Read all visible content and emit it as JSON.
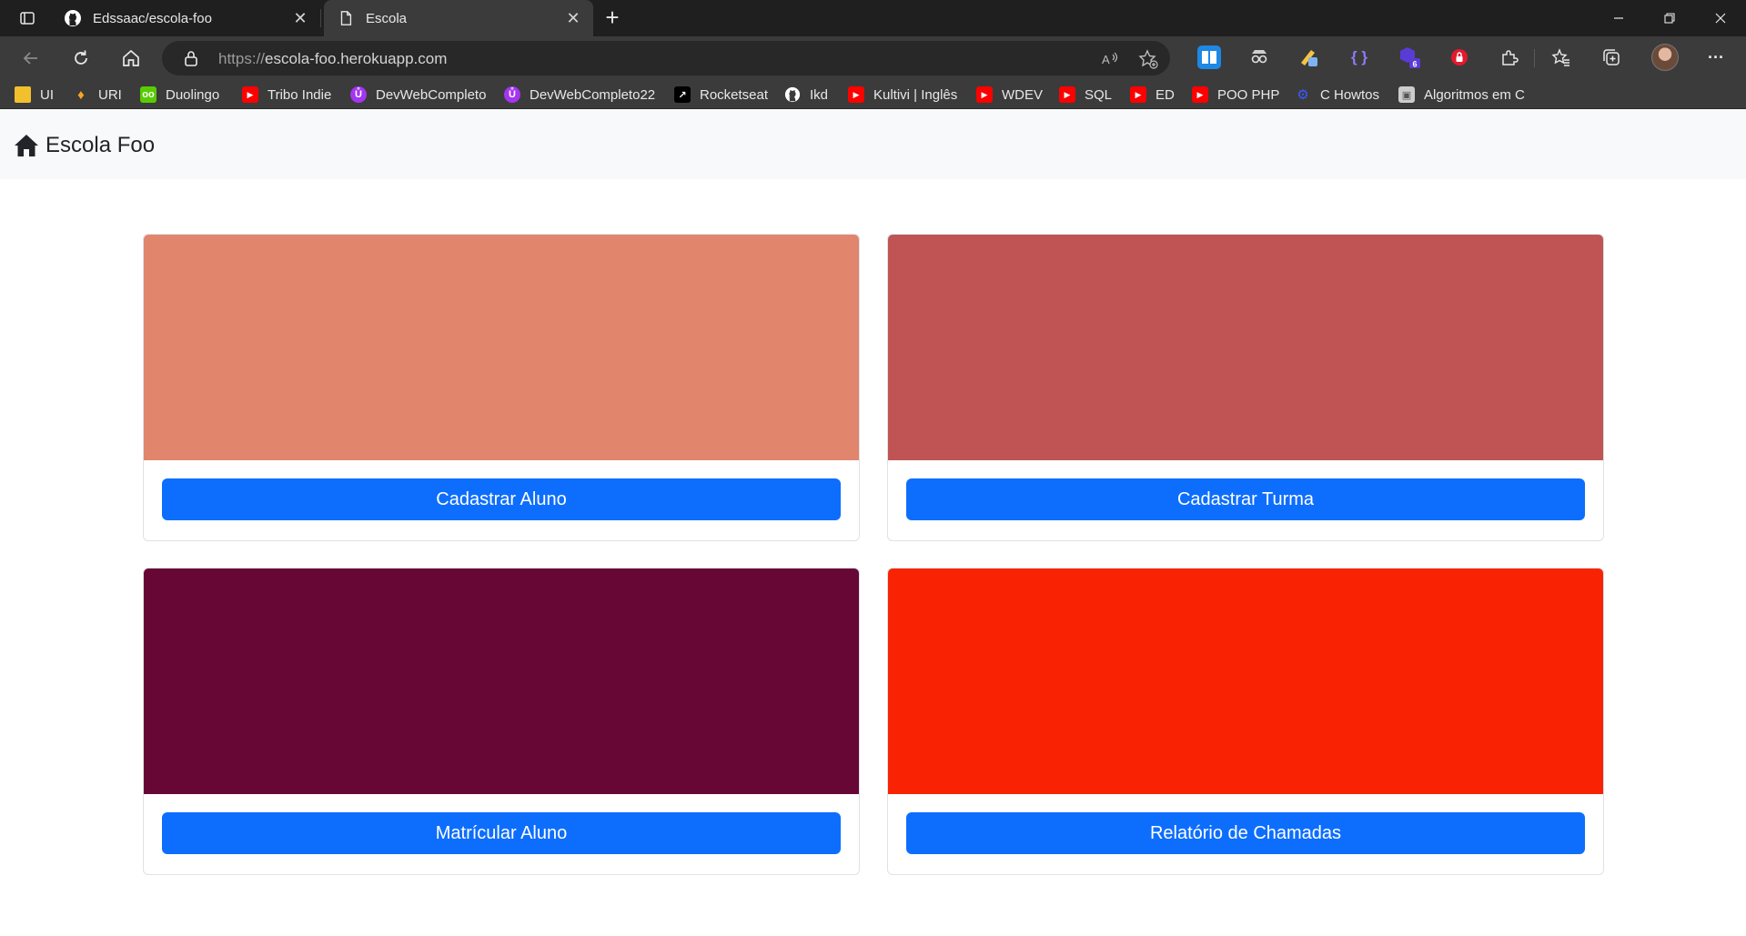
{
  "browser": {
    "tabs": [
      {
        "title": "Edssaac/escola-foo",
        "icon": "github-icon",
        "active": false
      },
      {
        "title": "Escola",
        "icon": "page-icon",
        "active": true
      }
    ],
    "address": {
      "protocol": "https://",
      "host": "escola-foo.herokuapp.com"
    },
    "bookmarks": [
      {
        "label": "UI",
        "icon": "folder-icon",
        "color": "#f2c02d"
      },
      {
        "label": "URI",
        "icon": "uri-icon",
        "color": "#3b3b3b"
      },
      {
        "label": "Duolingo",
        "icon": "duolingo-icon",
        "color": "#58cc02"
      },
      {
        "label": "Tribo Indie",
        "icon": "youtube-icon",
        "color": "#ff0000"
      },
      {
        "label": "DevWebCompleto",
        "icon": "udemy-icon",
        "color": "#a435f0"
      },
      {
        "label": "DevWebCompleto22",
        "icon": "udemy-icon",
        "color": "#a435f0"
      },
      {
        "label": "Rocketseat",
        "icon": "rocketseat-icon",
        "color": "#000000"
      },
      {
        "label": "Ikd",
        "icon": "github-icon",
        "color": "#3b3b3b"
      },
      {
        "label": "Kultivi | Inglês",
        "icon": "youtube-icon",
        "color": "#ff0000"
      },
      {
        "label": "WDEV",
        "icon": "youtube-icon",
        "color": "#ff0000"
      },
      {
        "label": "SQL",
        "icon": "youtube-icon",
        "color": "#ff0000"
      },
      {
        "label": "ED",
        "icon": "youtube-icon",
        "color": "#ff0000"
      },
      {
        "label": "POO PHP",
        "icon": "youtube-icon",
        "color": "#ff0000"
      },
      {
        "label": "C Howtos",
        "icon": "gear-icon",
        "color": "#3b3b3b"
      },
      {
        "label": "Algoritmos em C",
        "icon": "image-icon",
        "color": "#cccccc"
      }
    ],
    "extension_badge": "6"
  },
  "site": {
    "brand": "Escola Foo",
    "brand_icon": "home-icon"
  },
  "cards": [
    {
      "label": "Cadastrar Aluno",
      "color": "#e2856d"
    },
    {
      "label": "Cadastrar Turma",
      "color": "#c05455"
    },
    {
      "label": "Matrícular Aluno",
      "color": "#670736"
    },
    {
      "label": "Relatório de Chamadas",
      "color": "#f92304"
    }
  ],
  "colors": {
    "button_primary": "#0d6efd",
    "navbar_bg": "#f8f9fa"
  }
}
